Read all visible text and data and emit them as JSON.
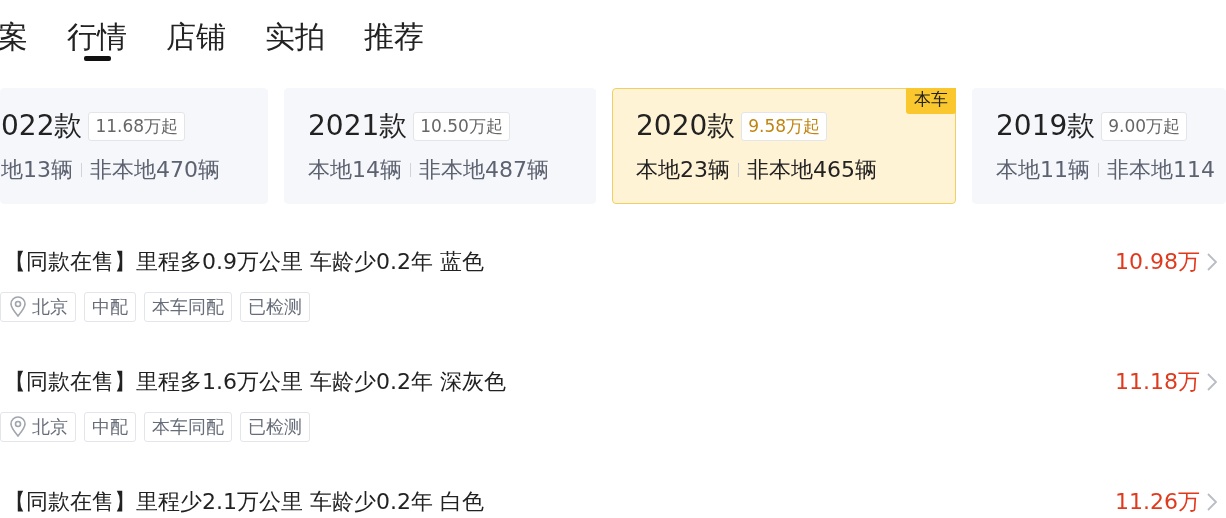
{
  "tabs": [
    {
      "label": "案",
      "selected": false
    },
    {
      "label": "行情",
      "selected": true
    },
    {
      "label": "店铺",
      "selected": false
    },
    {
      "label": "实拍",
      "selected": false
    },
    {
      "label": "推荐",
      "selected": false
    }
  ],
  "year_cards": [
    {
      "year": "022款",
      "price": "11.68万起",
      "local": "地13辆",
      "nonlocal": "非本地470辆",
      "selected": false
    },
    {
      "year": "2021款",
      "price": "10.50万起",
      "local": "本地14辆",
      "nonlocal": "非本地487辆",
      "selected": false
    },
    {
      "year": "2020款",
      "price": "9.58万起",
      "local": "本地23辆",
      "nonlocal": "非本地465辆",
      "selected": true,
      "badge": "本车"
    },
    {
      "year": "2019款",
      "price": "9.00万起",
      "local": "本地11辆",
      "nonlocal": "非本地114",
      "selected": false
    }
  ],
  "listings": [
    {
      "title": "【同款在售】里程多0.9万公里 车龄少0.2年 蓝色",
      "price": "10.98万",
      "tags": [
        {
          "text": "北京",
          "kind": "location"
        },
        {
          "text": "中配",
          "kind": "plain"
        },
        {
          "text": "本车同配",
          "kind": "plain"
        },
        {
          "text": "已检测",
          "kind": "plain"
        }
      ]
    },
    {
      "title": "【同款在售】里程多1.6万公里 车龄少0.2年 深灰色",
      "price": "11.18万",
      "tags": [
        {
          "text": "北京",
          "kind": "location"
        },
        {
          "text": "中配",
          "kind": "plain"
        },
        {
          "text": "本车同配",
          "kind": "plain"
        },
        {
          "text": "已检测",
          "kind": "plain"
        }
      ]
    },
    {
      "title": "【同款在售】里程少2.1万公里 车龄少0.2年 白色",
      "price": "11.26万"
    }
  ]
}
